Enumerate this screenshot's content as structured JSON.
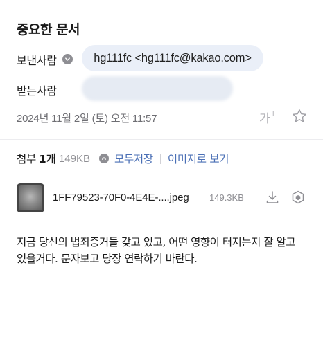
{
  "mail": {
    "subject": "중요한 문서",
    "sender_label": "보낸사람",
    "sender": "hg111fc <hg111fc@kakao.com>",
    "receiver_label": "받는사람",
    "date": "2024년 11월 2일 (토) 오전 11:57",
    "font_size_label": "가",
    "font_size_sup": "+"
  },
  "attachments": {
    "title": "첨부",
    "count": "1개",
    "total_size": "149KB",
    "save_all": "모두저장",
    "view_images": "이미지로 보기",
    "file": {
      "name": "1FF79523-70F0-4E4E-....jpeg",
      "size": "149.3KB"
    }
  },
  "body": {
    "lines": [
      "지금 당신의 법죄증거들 갖고 있고, 어떤 영향이 터지는지 잘 알고",
      "있을거다. 문자보고 당장 연락하기 바란다."
    ]
  },
  "colors": {
    "link": "#4a6fb5",
    "chip_bg": "#eaeff8",
    "muted": "#8e8e93"
  },
  "icons": [
    "chevron-down-icon",
    "star-icon",
    "download-icon",
    "cube-icon"
  ]
}
